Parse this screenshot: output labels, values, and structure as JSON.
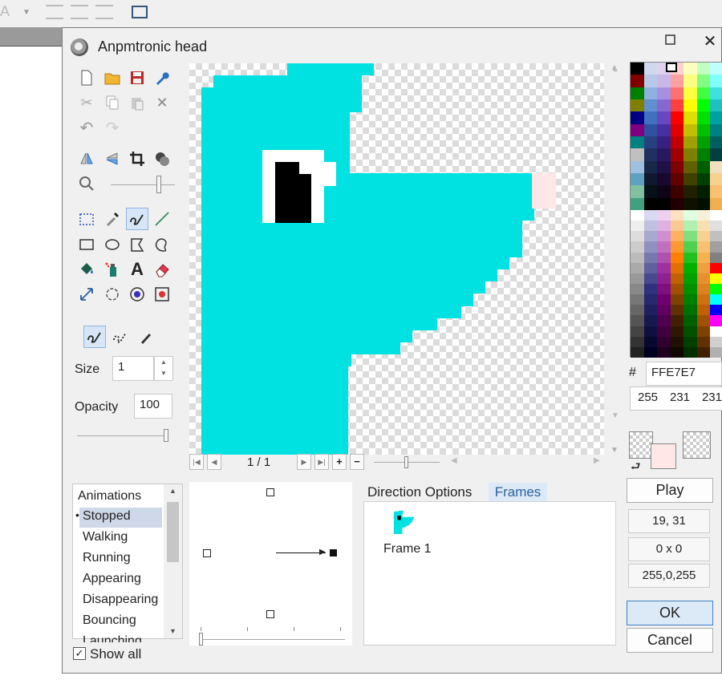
{
  "dialog": {
    "title": "Anpmtronic head"
  },
  "size": {
    "label": "Size",
    "value": "1"
  },
  "opacity": {
    "label": "Opacity",
    "value": "100"
  },
  "canvas": {
    "frame_counter": "1 / 1"
  },
  "color": {
    "hash_label": "#",
    "hex": "FFE7E7",
    "r": "255",
    "g": "231",
    "b": "231"
  },
  "colors": {
    "sprite": "#00e1e1",
    "eye_white": "#ffffff",
    "eye_black": "#000000",
    "selected": "#ffe7e7"
  },
  "buttons": {
    "play": "Play",
    "ok": "OK",
    "cancel": "Cancel"
  },
  "info": {
    "position": "19, 31",
    "size": "0 x 0",
    "color": "255,0,255"
  },
  "animations": {
    "header": "Animations",
    "items": [
      "Stopped",
      "Walking",
      "Running",
      "Appearing",
      "Disappearing",
      "Bouncing",
      "Launching"
    ],
    "selected": "Stopped",
    "show_all": "Show all"
  },
  "tabs": {
    "direction": "Direction Options",
    "frames": "Frames"
  },
  "frames": {
    "items": [
      {
        "label": "Frame 1"
      }
    ]
  }
}
